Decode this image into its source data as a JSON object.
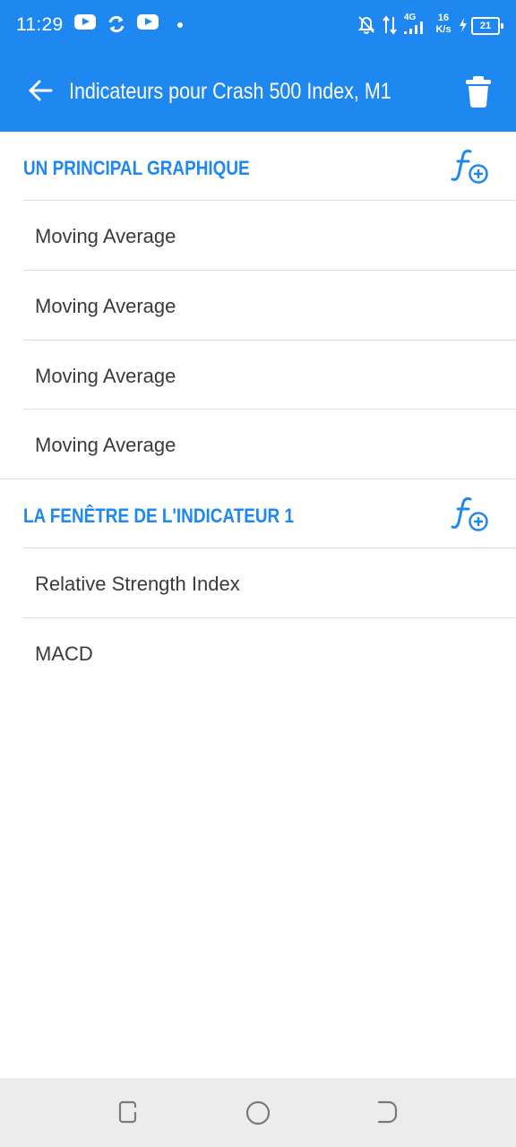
{
  "status_bar": {
    "time": "11:29",
    "net_speed_value": "16",
    "net_speed_unit": "K/s",
    "network_type": "4G",
    "battery": "21",
    "icons": [
      "youtube-icon",
      "sync-icon",
      "youtube-icon",
      "notification-dot",
      "bell-off-icon",
      "data-arrows-icon",
      "signal-icon",
      "charging-icon",
      "battery-icon"
    ]
  },
  "app_bar": {
    "title": "Indicateurs pour Crash 500 Index, M1",
    "back_icon": "arrow-left-icon",
    "delete_icon": "trash-icon"
  },
  "sections": [
    {
      "header": "UN PRINCIPAL GRAPHIQUE",
      "add_icon": "function-add-icon",
      "items": [
        "Moving Average",
        "Moving Average",
        "Moving Average",
        "Moving Average"
      ]
    },
    {
      "header": "LA FENÊTRE DE L'INDICATEUR 1",
      "add_icon": "function-add-icon",
      "items": [
        "Relative Strength Index",
        "MACD"
      ]
    }
  ],
  "nav_bar": {
    "buttons": [
      "recent-apps-icon",
      "home-icon",
      "back-icon"
    ]
  },
  "colors": {
    "accent": "#1e88f0",
    "text": "#3a3a3a",
    "divider": "#dddddd",
    "nav_bg": "#ececec"
  }
}
